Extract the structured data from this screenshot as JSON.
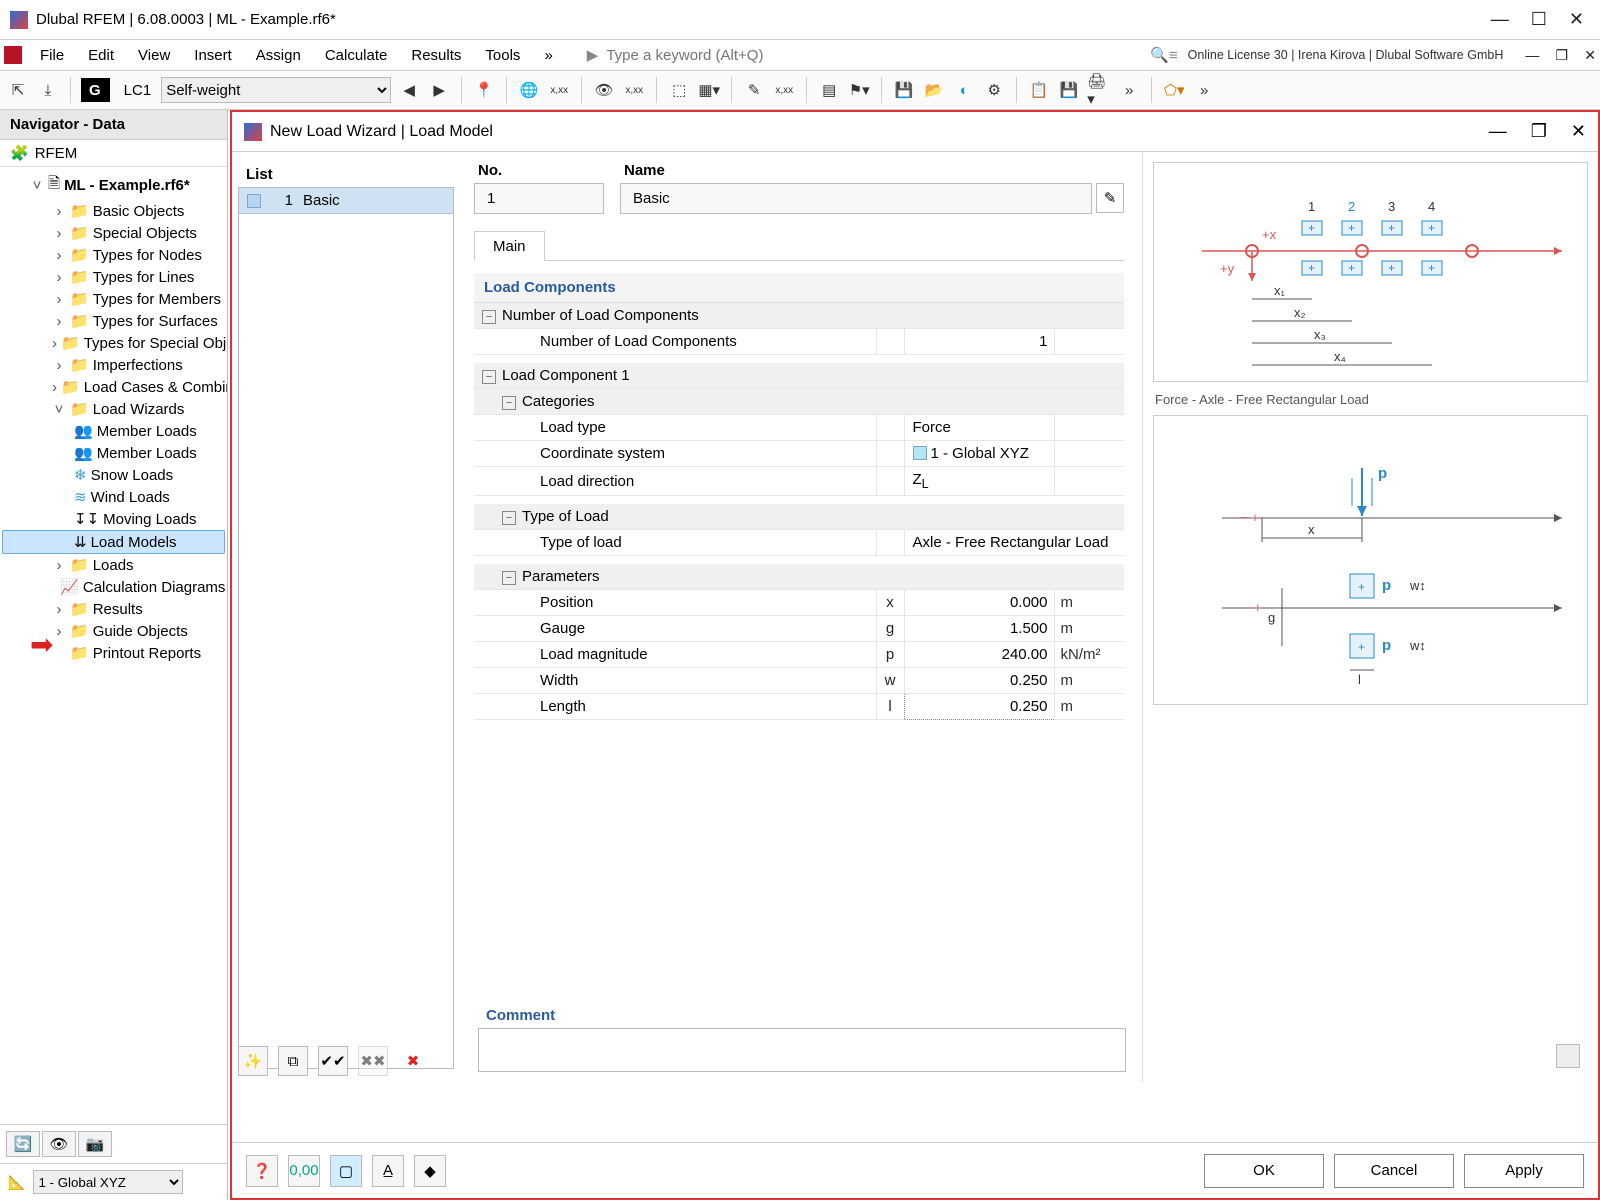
{
  "titlebar": {
    "app_title": "Dlubal RFEM | 6.08.0003 | ML - Example.rf6*"
  },
  "menubar": {
    "items": [
      "File",
      "Edit",
      "View",
      "Insert",
      "Assign",
      "Calculate",
      "Results",
      "Tools"
    ],
    "keyword_placeholder": "Type a keyword (Alt+Q)",
    "license_text": "Online License 30 | Irena Kirova | Dlubal Software GmbH"
  },
  "toolbar": {
    "gbtn": "G",
    "lc_label": "LC1",
    "lc_select": "Self-weight"
  },
  "navigator": {
    "title": "Navigator - Data",
    "root": "RFEM",
    "project": "ML - Example.rf6*",
    "folders": [
      "Basic Objects",
      "Special Objects",
      "Types for Nodes",
      "Types for Lines",
      "Types for Members",
      "Types for Surfaces",
      "Types for Special Objects",
      "Imperfections",
      "Load Cases & Combinations"
    ],
    "load_wizards_label": "Load Wizards",
    "load_wizards": [
      "Member Loads",
      "Member Loads",
      "Snow Loads",
      "Wind Loads",
      "Moving Loads",
      "Load Models"
    ],
    "after_wizards": [
      "Loads",
      "Calculation Diagrams",
      "Results",
      "Guide Objects",
      "Printout Reports"
    ],
    "coord_select": "1 - Global XYZ"
  },
  "dialog": {
    "title": "New Load Wizard | Load Model",
    "list_head": "List",
    "list_item_no": "1",
    "list_item_name": "Basic",
    "no_head": "No.",
    "no_value": "1",
    "name_head": "Name",
    "name_value": "Basic",
    "tab_main": "Main",
    "sec_load_components": "Load Components",
    "row_number_group": "Number of Load Components",
    "row_number_label": "Number of Load Components",
    "row_number_value": "1",
    "sec_lc1": "Load Component 1",
    "cat_label": "Categories",
    "cat_load_type": "Load type",
    "cat_load_type_val": "Force",
    "cat_coord": "Coordinate system",
    "cat_coord_val": "1 - Global XYZ",
    "cat_dir": "Load direction",
    "cat_dir_val": "Z",
    "cat_dir_sub": "L",
    "type_label": "Type of Load",
    "type_of_load": "Type of load",
    "type_of_load_val": "Axle - Free Rectangular Load",
    "params_label": "Parameters",
    "p_position": "Position",
    "p_position_sym": "x",
    "p_position_val": "0.000",
    "p_position_unit": "m",
    "p_gauge": "Gauge",
    "p_gauge_sym": "g",
    "p_gauge_val": "1.500",
    "p_gauge_unit": "m",
    "p_mag": "Load magnitude",
    "p_mag_sym": "p",
    "p_mag_val": "240.00",
    "p_mag_unit": "kN/m²",
    "p_width": "Width",
    "p_width_sym": "w",
    "p_width_val": "0.250",
    "p_width_unit": "m",
    "p_length": "Length",
    "p_length_sym": "l",
    "p_length_val": "0.250",
    "p_length_unit": "m",
    "diag1_nums": [
      "1",
      "2",
      "3",
      "4"
    ],
    "diag1_plusx": "+x",
    "diag1_plusy": "+y",
    "diag1_dims": [
      "x₁",
      "x₂",
      "x₃",
      "x₄"
    ],
    "diag2_caption": "Force - Axle - Free Rectangular Load",
    "diag2_p": "p",
    "diag2_w": "w",
    "diag2_g": "g",
    "diag2_x": "x",
    "diag2_l": "l",
    "comment_label": "Comment",
    "btn_ok": "OK",
    "btn_cancel": "Cancel",
    "btn_apply": "Apply"
  }
}
